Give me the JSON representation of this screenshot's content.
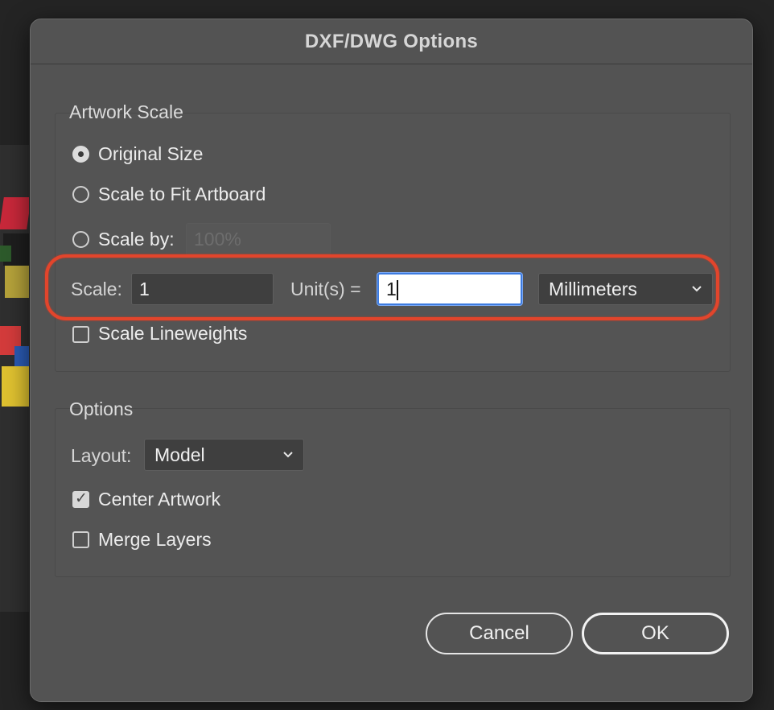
{
  "dialog": {
    "title": "DXF/DWG Options"
  },
  "artwork_scale": {
    "group_title": "Artwork Scale",
    "options": [
      {
        "label": "Original Size",
        "selected": true
      },
      {
        "label": "Scale to Fit Artboard",
        "selected": false
      },
      {
        "label": "Scale by:",
        "selected": false
      }
    ],
    "scale_by_value": "100%",
    "scale_label": "Scale:",
    "scale_value": "1",
    "units_label": "Unit(s) =",
    "units_value": "1",
    "unit_select": {
      "selected": "Millimeters"
    },
    "scale_lineweights": {
      "label": "Scale Lineweights",
      "checked": false
    }
  },
  "options": {
    "group_title": "Options",
    "layout_label": "Layout:",
    "layout_select": {
      "selected": "Model"
    },
    "center_artwork": {
      "label": "Center Artwork",
      "checked": true
    },
    "merge_layers": {
      "label": "Merge Layers",
      "checked": false
    }
  },
  "buttons": {
    "cancel": "Cancel",
    "ok": "OK"
  },
  "colors": {
    "annotation_highlight": "#e2452c",
    "focus_ring": "#3d7be0",
    "dialog_bg": "#535353"
  }
}
